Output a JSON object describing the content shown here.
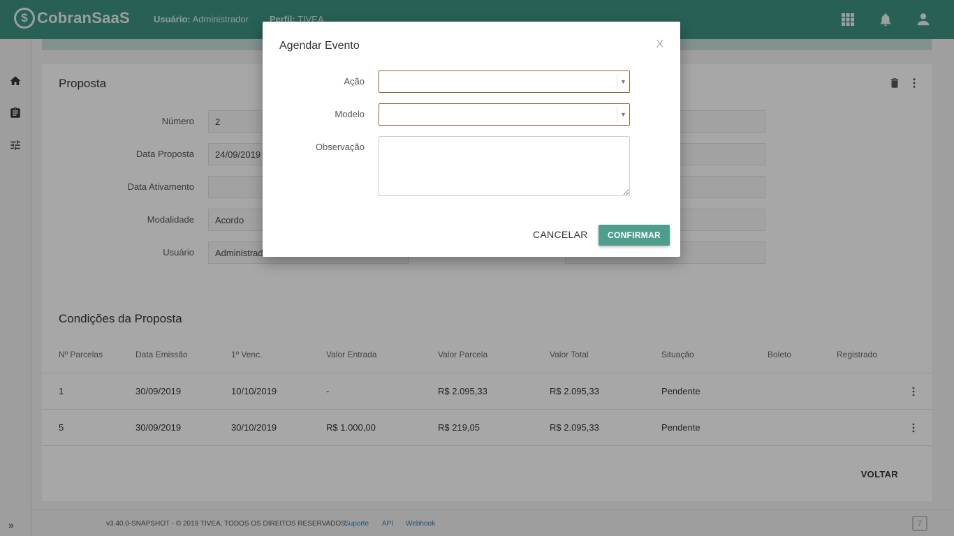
{
  "app": {
    "name": "CobranSaaS",
    "logo_glyph": "$"
  },
  "header": {
    "user_label": "Usuário:",
    "user_value": "Administrador",
    "profile_label": "Perfil:",
    "profile_value": "TIVEA",
    "icons": [
      "apps-grid-icon",
      "bell-icon",
      "account-icon"
    ]
  },
  "sidebar": {
    "icons": [
      "home-icon",
      "clipboard-icon",
      "tune-icon"
    ],
    "expand_glyph": "»"
  },
  "proposal": {
    "title": "Proposta",
    "fields": [
      {
        "label": "Número",
        "value": "2"
      },
      {
        "label": "Data Proposta",
        "value": "24/09/2019"
      },
      {
        "label": "Data Ativamento",
        "value": ""
      },
      {
        "label": "Modalidade",
        "value": "Acordo"
      },
      {
        "label": "Usuário",
        "value": "Administrador"
      }
    ]
  },
  "conditions": {
    "title": "Condições da Proposta",
    "columns": [
      "Nº Parcelas",
      "Data Emissão",
      "1º Venc.",
      "Valor Entrada",
      "Valor Parcela",
      "Valor Total",
      "Situação",
      "Boleto",
      "Registrado"
    ],
    "rows": [
      [
        "1",
        "30/09/2019",
        "10/10/2019",
        "-",
        "R$ 2.095,33",
        "R$ 2.095,33",
        "Pendente",
        "",
        ""
      ],
      [
        "5",
        "30/09/2019",
        "30/10/2019",
        "R$ 1.000,00",
        "R$ 219,05",
        "R$ 2.095,33",
        "Pendente",
        "",
        ""
      ]
    ],
    "back_label": "VOLTAR"
  },
  "footer": {
    "version": "v3.40.0-SNAPSHOT - © 2019 TIVEA. TODOS OS DIREITOS RESERVADOS.",
    "links": [
      "Suporte",
      "API",
      "Webhook"
    ]
  },
  "modal": {
    "title": "Agendar Evento",
    "close": "X",
    "action_label": "Ação",
    "action_value": "",
    "model_label": "Modelo",
    "model_value": "",
    "observation_label": "Observação",
    "observation_value": "",
    "cancel_label": "CANCELAR",
    "confirm_label": "CONFIRMAR"
  },
  "colors": {
    "header": "#3d8f7f",
    "confirm": "#4e9e8d",
    "select_border": "#8a6b2c"
  }
}
